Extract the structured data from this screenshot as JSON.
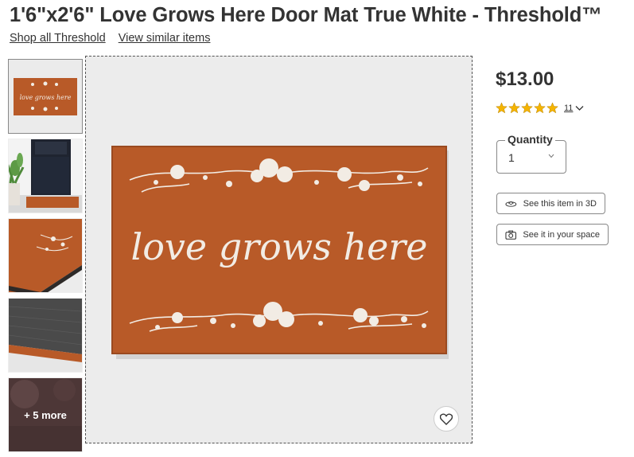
{
  "product": {
    "title": "1'6\"x2'6\" Love Grows Here Door Mat True White - Threshold™",
    "shop_all_link": "Shop all Threshold",
    "similar_link": "View similar items",
    "price": "$13.00",
    "rating_value": 5,
    "rating_count": "11",
    "quantity_label": "Quantity",
    "quantity_value": "1",
    "see_3d_label": "See this item in 3D",
    "see_space_label": "See it in your space",
    "mat_text": "love grows here",
    "more_images_label": "+ 5 more"
  },
  "colors": {
    "mat": "#b85a28",
    "mat_border": "#9a4a20",
    "star": "#f5b400",
    "print": "#f2ece4"
  },
  "icons": {
    "rating_toggle": "chevron-down-icon",
    "quantity_dropdown": "caret-down-icon",
    "see_3d": "3d-view-icon",
    "see_space": "camera-icon",
    "favorite": "heart-icon"
  }
}
